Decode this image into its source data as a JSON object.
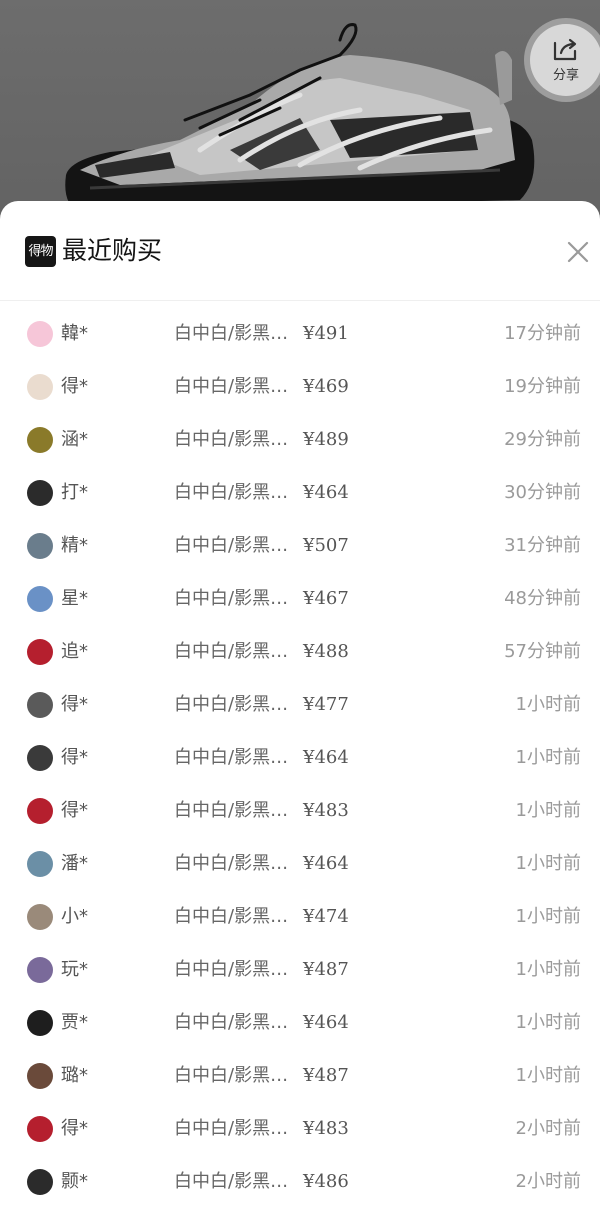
{
  "share": {
    "label": "分享",
    "icon": "share-icon"
  },
  "sheet": {
    "logo_text": "得物",
    "title": "最近购买",
    "close_icon": "close-icon"
  },
  "purchases": [
    {
      "user": "韓*",
      "variant": "白中白/影黑…",
      "price": "¥491",
      "time": "17分钟前",
      "avatar_color": "#f6c6d8"
    },
    {
      "user": "得*",
      "variant": "白中白/影黑…",
      "price": "¥469",
      "time": "19分钟前",
      "avatar_color": "#eadccf"
    },
    {
      "user": "涵*",
      "variant": "白中白/影黑…",
      "price": "¥489",
      "time": "29分钟前",
      "avatar_color": "#8a7a2a"
    },
    {
      "user": "打*",
      "variant": "白中白/影黑…",
      "price": "¥464",
      "time": "30分钟前",
      "avatar_color": "#2b2b2b"
    },
    {
      "user": "精*",
      "variant": "白中白/影黑…",
      "price": "¥507",
      "time": "31分钟前",
      "avatar_color": "#6a7d8c"
    },
    {
      "user": "星*",
      "variant": "白中白/影黑…",
      "price": "¥467",
      "time": "48分钟前",
      "avatar_color": "#6a91c6"
    },
    {
      "user": "追*",
      "variant": "白中白/影黑…",
      "price": "¥488",
      "time": "57分钟前",
      "avatar_color": "#b51f2e"
    },
    {
      "user": "得*",
      "variant": "白中白/影黑…",
      "price": "¥477",
      "time": "1小时前",
      "avatar_color": "#5a5a5a"
    },
    {
      "user": "得*",
      "variant": "白中白/影黑…",
      "price": "¥464",
      "time": "1小时前",
      "avatar_color": "#3a3a3a"
    },
    {
      "user": "得*",
      "variant": "白中白/影黑…",
      "price": "¥483",
      "time": "1小时前",
      "avatar_color": "#b51f2e"
    },
    {
      "user": "潘*",
      "variant": "白中白/影黑…",
      "price": "¥464",
      "time": "1小时前",
      "avatar_color": "#6b8fa6"
    },
    {
      "user": "小*",
      "variant": "白中白/影黑…",
      "price": "¥474",
      "time": "1小时前",
      "avatar_color": "#9a8a7a"
    },
    {
      "user": "玩*",
      "variant": "白中白/影黑…",
      "price": "¥487",
      "time": "1小时前",
      "avatar_color": "#7a6a9a"
    },
    {
      "user": "贾*",
      "variant": "白中白/影黑…",
      "price": "¥464",
      "time": "1小时前",
      "avatar_color": "#1e1e1e"
    },
    {
      "user": "璐*",
      "variant": "白中白/影黑…",
      "price": "¥487",
      "time": "1小时前",
      "avatar_color": "#6a4a3a"
    },
    {
      "user": "得*",
      "variant": "白中白/影黑…",
      "price": "¥483",
      "time": "2小时前",
      "avatar_color": "#b51f2e"
    },
    {
      "user": "颢*",
      "variant": "白中白/影黑…",
      "price": "¥486",
      "time": "2小时前",
      "avatar_color": "#2b2b2b"
    }
  ]
}
